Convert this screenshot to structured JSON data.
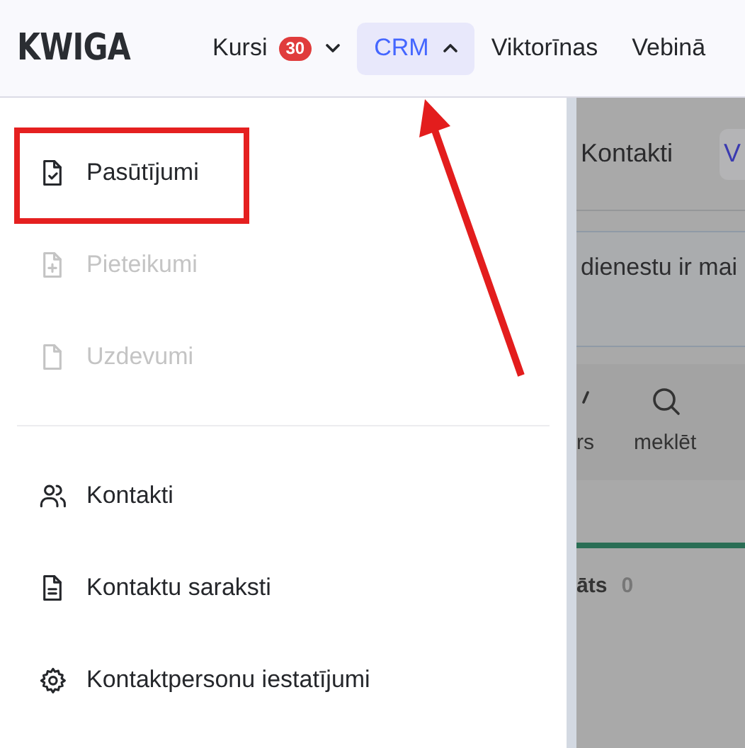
{
  "logo": "KWIGA",
  "nav": [
    {
      "label": "Kursi",
      "badge": "30",
      "expanded": false,
      "selected": false
    },
    {
      "label": "CRM",
      "expanded": true,
      "selected": true
    },
    {
      "label": "Viktorīnas",
      "selected": false
    },
    {
      "label": "Vebinā",
      "selected": false
    }
  ],
  "menu": {
    "groups": [
      [
        {
          "label": "Pasūtījumi",
          "disabled": false,
          "highlighted": true
        },
        {
          "label": "Pieteikumi",
          "disabled": true,
          "highlighted": false
        },
        {
          "label": "Uzdevumi",
          "disabled": true,
          "highlighted": false
        }
      ],
      [
        {
          "label": "Kontakti",
          "disabled": false,
          "highlighted": false
        },
        {
          "label": "Kontaktu saraksti",
          "disabled": false,
          "highlighted": false
        },
        {
          "label": "Kontaktpersonu iestatījumi",
          "disabled": false,
          "highlighted": false
        }
      ]
    ]
  },
  "arrow_to_selected_tab": true,
  "background_page": {
    "title": "Kontakti",
    "button_text": "V",
    "notice": "dienestu ir mai",
    "toolbar": [
      {
        "label": "rs"
      },
      {
        "label": "meklēt"
      }
    ],
    "tab": {
      "label": "āts",
      "count": "0"
    }
  }
}
